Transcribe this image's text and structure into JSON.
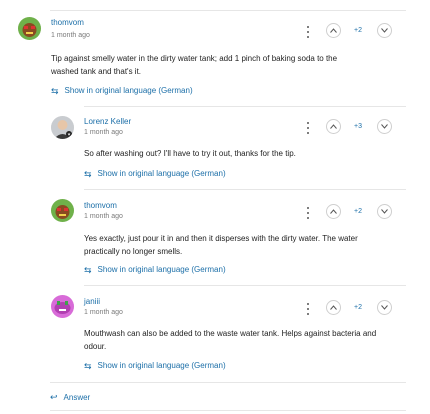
{
  "comments": [
    {
      "author": "thomvom",
      "time": "1 month ago",
      "body": "Tip against smelly water in the dirty water tank; add 1 pinch of baking soda to the washed tank and that's it.",
      "translate": "Show in original language (German)",
      "votes": "+2"
    },
    {
      "author": "Lorenz Keller",
      "time": "1 month ago",
      "body": "So after washing out? I'll have to try it out, thanks for the tip.",
      "translate": "Show in original language (German)",
      "votes": "+3"
    },
    {
      "author": "thomvom",
      "time": "1 month ago",
      "body": "Yes exactly, just pour it in and then it disperses with the dirty water. The water practically no longer smells.",
      "translate": "Show in original language (German)",
      "votes": "+2"
    },
    {
      "author": "janiii",
      "time": "1 month ago",
      "body": "Mouthwash can also be added to the waste water tank. Helps against bacteria and odour.",
      "translate": "Show in original language (German)",
      "votes": "+2"
    }
  ],
  "answer_label": "Answer",
  "icons": {
    "translate": "translate-icon",
    "more": "kebab-menu-icon",
    "upvote": "chevron-up-icon",
    "downvote": "chevron-down-icon",
    "reply": "reply-arrow-icon"
  },
  "colors": {
    "link": "#1c6fa8",
    "text": "#1f1f1f",
    "muted": "#7a7a7a",
    "divider": "#e6e6e6"
  }
}
